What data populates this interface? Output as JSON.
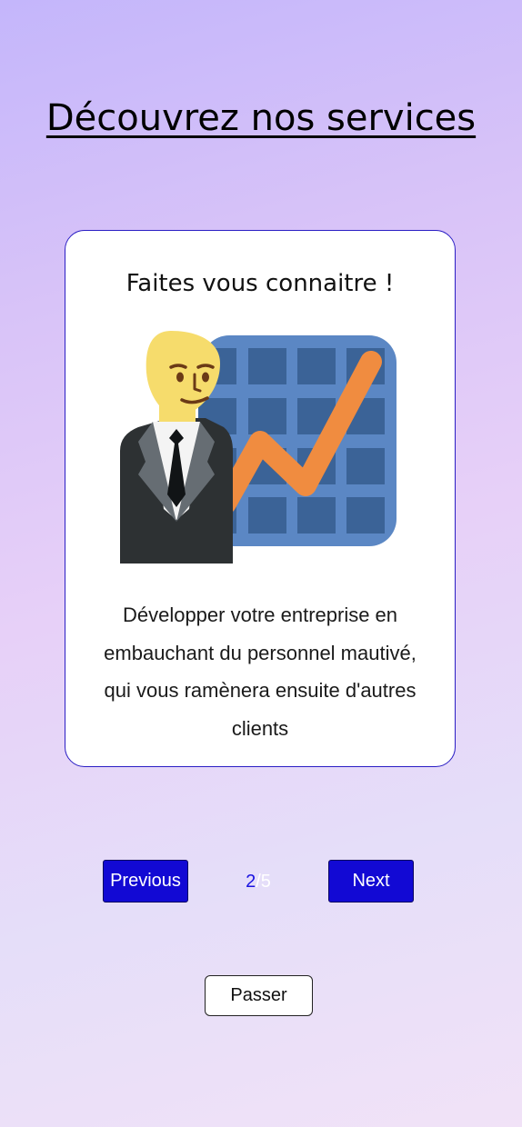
{
  "header": {
    "title": "Découvrez nos services"
  },
  "card": {
    "title": "Faites vous connaitre !",
    "illustration": "businessman-chart-icon",
    "description": "Développer votre entreprise en embauchant du personnel mautivé, qui vous ramènera ensuite d'autres clients"
  },
  "pagination": {
    "previous_label": "Previous",
    "next_label": "Next",
    "current": "2",
    "separator": "/",
    "total": "5"
  },
  "actions": {
    "skip_label": "Passer"
  },
  "colors": {
    "primary_button": "#1209d4",
    "card_border": "#2a1ec4",
    "chart_grid": "#5b87c4",
    "chart_cells": "#3b6397",
    "chart_line": "#f08c40",
    "skin": "#f6dc6c",
    "suit": "#2d3133"
  }
}
